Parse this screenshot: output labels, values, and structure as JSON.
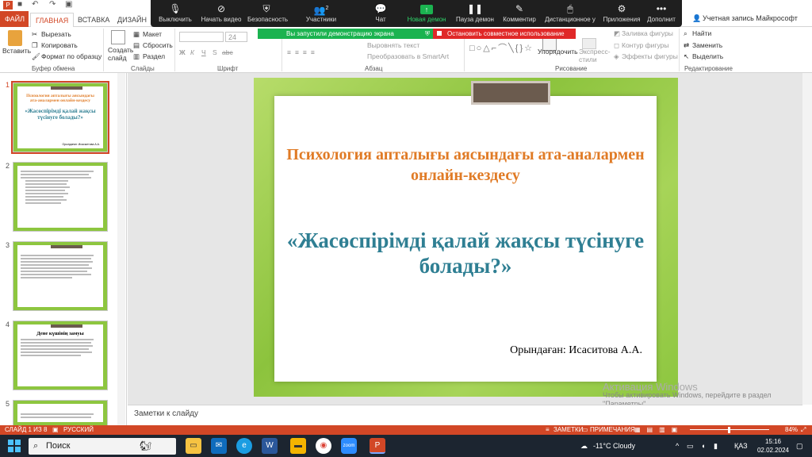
{
  "qat": {
    "icons": [
      "save-icon",
      "undo-icon",
      "redo-icon",
      "start-slideshow-icon"
    ]
  },
  "tabs": [
    {
      "label": "ФАЙЛ"
    },
    {
      "label": "ГЛАВНАЯ"
    },
    {
      "label": "ВСТАВКА"
    },
    {
      "label": "ДИЗАЙН"
    }
  ],
  "account": {
    "label": "Учетная запись Майкрософт"
  },
  "zoom_toolbar": {
    "items": [
      {
        "label": "Выключить",
        "icon": "microphone-icon"
      },
      {
        "label": "Начать видео",
        "icon": "video-off-icon"
      },
      {
        "label": "Безопасность",
        "icon": "shield-icon"
      },
      {
        "label": "Участники",
        "icon": "participants-icon",
        "count": "2"
      },
      {
        "label": "Чат",
        "icon": "chat-icon"
      },
      {
        "label": "Новая демон",
        "icon": "share-screen-icon"
      },
      {
        "label": "Пауза демон",
        "icon": "pause-icon"
      },
      {
        "label": "Комментир",
        "icon": "annotate-icon"
      },
      {
        "label": "Дистанционное у",
        "icon": "remote-control-icon"
      },
      {
        "label": "Приложения",
        "icon": "apps-icon"
      },
      {
        "label": "Дополнит",
        "icon": "more-icon"
      }
    ],
    "sharing_text": "Вы запустили демонстрацию экрана",
    "stop_share": "Остановить совместное использование"
  },
  "ribbon": {
    "paste": "Вставить",
    "cut": "Вырезать",
    "copy": "Копировать",
    "format_painter": "Формат по образцу",
    "clipboard_group": "Буфер обмена",
    "new_slide": "Создать слайд",
    "layout": "Макет",
    "reset": "Сбросить",
    "section": "Раздел",
    "slides_group": "Слайды",
    "font_size": "24",
    "font_group": "Шрифт",
    "font_buttons": [
      "Ж",
      "К",
      "Ч",
      "S",
      "abc"
    ],
    "text_direction": "Выровнять текст",
    "smartart": "Преобразовать в SmartArt",
    "paragraph_group": "Абзац",
    "arrange": "Упорядочить",
    "quick_styles": "Экспресс-стили",
    "shape_fill": "Заливка фигуры",
    "shape_outline": "Контур фигуры",
    "shape_effects": "Эффекты фигуры",
    "drawing_group": "Рисование",
    "find": "Найти",
    "replace": "Заменить",
    "select": "Выделить",
    "editing_group": "Редактирование"
  },
  "thumbnails": [
    {
      "num": "1",
      "title": "Психология апталығы аясындағы ата-аналармен онлайн-кездесу",
      "subtitle": "«Жасөспірімді қалай жақсы түсінуге болады?»",
      "author": "Орындаған: Исасыптова А.А."
    },
    {
      "num": "2"
    },
    {
      "num": "3"
    },
    {
      "num": "4",
      "title": "Дене күшінің замуы"
    },
    {
      "num": "5"
    }
  ],
  "slide": {
    "title": "Психология апталығы аясындағы ата-аналармен онлайн-кездесу",
    "subtitle": "«Жасөспірімді қалай жақсы түсінуге болады?»",
    "author": "Орындаған: Исаситова А.А."
  },
  "notes_placeholder": "Заметки к слайду",
  "activation": {
    "title": "Активация Windows",
    "line1": "Чтобы активировать Windows, перейдите в раздел",
    "line2": "\"Параметры\"."
  },
  "status": {
    "slide": "СЛАЙД 1 ИЗ 8",
    "language": "РУССКИЙ",
    "notes": "ЗАМЕТКИ",
    "comments": "ПРИМЕЧАНИЯ",
    "zoom": "84%"
  },
  "taskbar": {
    "search": "Поиск",
    "weather": "-11°C Cloudy",
    "lang": "ҚАЗ",
    "time": "15:16",
    "date": "02.02.2024"
  },
  "colors": {
    "accent": "#d24726",
    "zoom_green": "#1bb350",
    "zoom_red": "#e02828",
    "slide_title": "#e07b26",
    "slide_subtitle": "#2f7f93"
  }
}
